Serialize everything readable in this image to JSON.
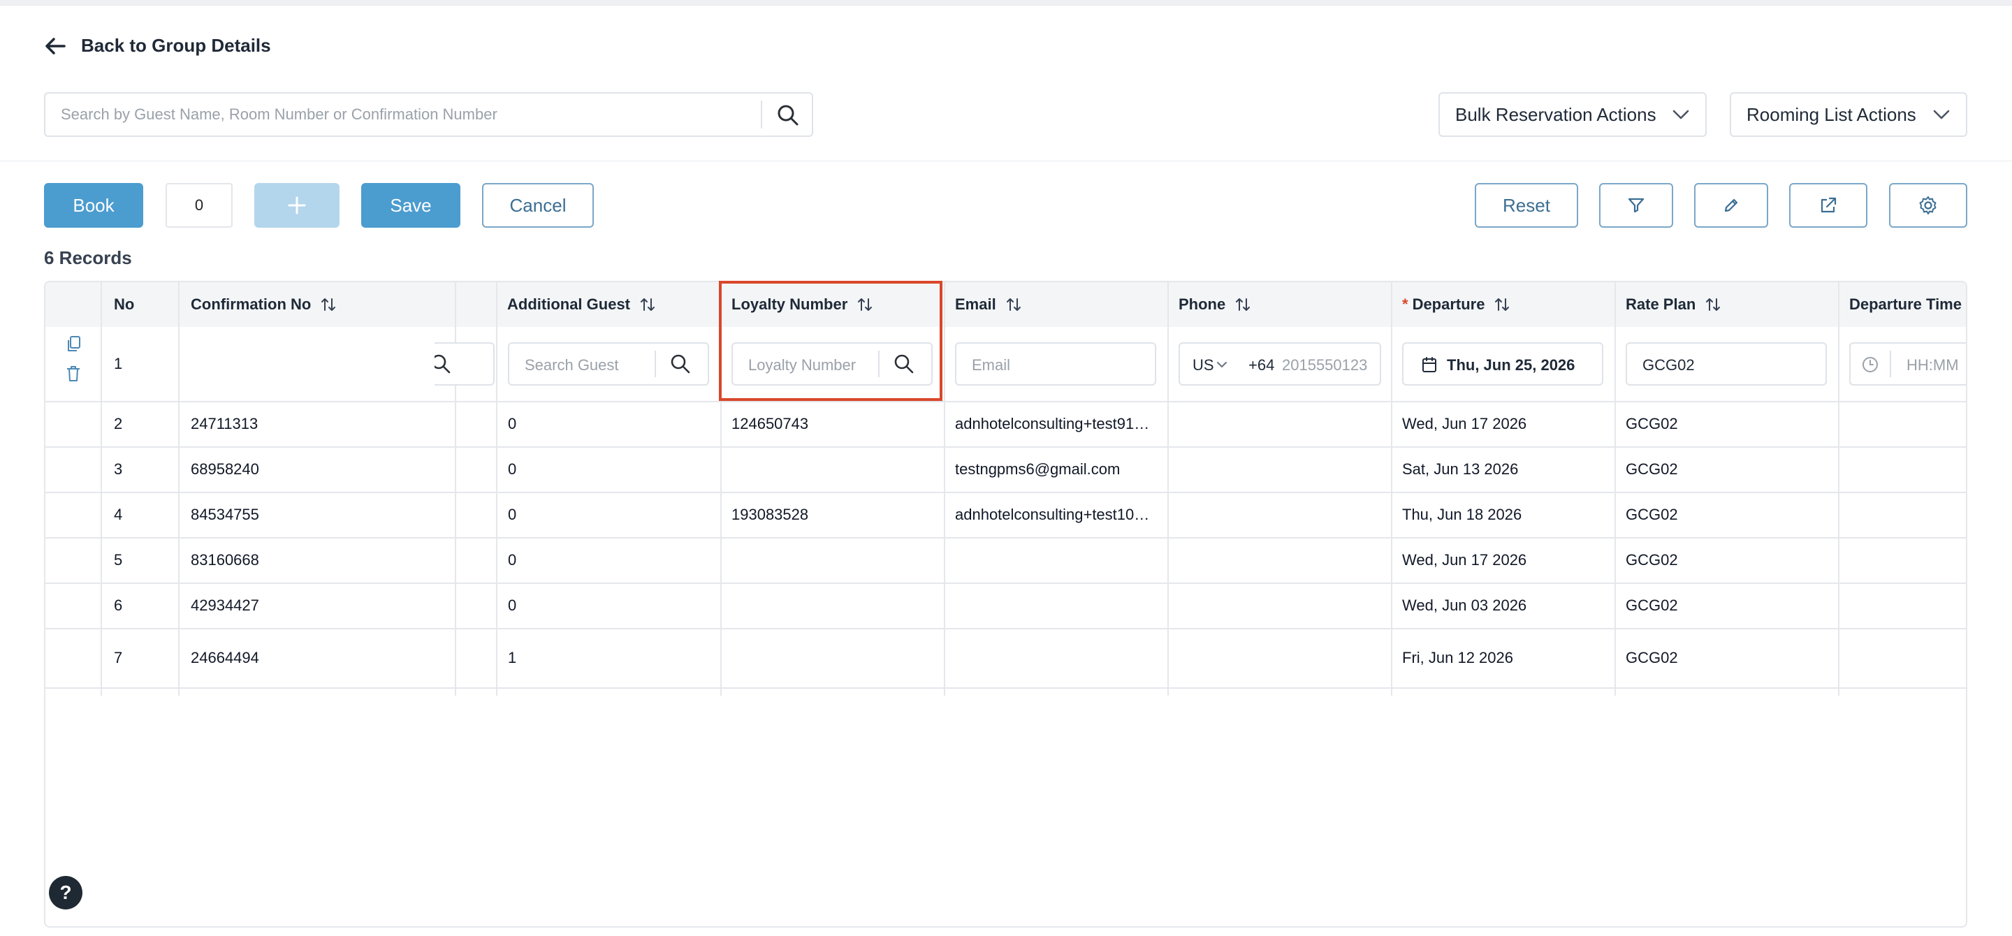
{
  "nav": {
    "back_label": "Back to Group Details"
  },
  "search": {
    "placeholder": "Search by Guest Name, Room Number or Confirmation Number",
    "value": ""
  },
  "header_actions": {
    "bulk_label": "Bulk Reservation Actions",
    "rooming_label": "Rooming List Actions"
  },
  "toolbar": {
    "book_label": "Book",
    "quantity": "0",
    "save_label": "Save",
    "cancel_label": "Cancel",
    "reset_label": "Reset"
  },
  "records_label": "6 Records",
  "columns": {
    "no": "No",
    "confirmation": "Confirmation No",
    "additional_guest": "Additional Guest",
    "loyalty": "Loyalty Number",
    "email": "Email",
    "phone": "Phone",
    "departure_required": "*",
    "departure": "Departure",
    "rate_plan": "Rate Plan",
    "departure_time": "Departure Time"
  },
  "new_row": {
    "no": "1",
    "guest_placeholder": "Search Guest",
    "loyalty_placeholder": "Loyalty Number",
    "email_placeholder": "Email",
    "phone_country": "US",
    "phone_code": "+64",
    "phone_placeholder": "2015550123",
    "departure_value": "Thu, Jun 25, 2026",
    "rate_plan_value": "GCG02",
    "time_placeholder": "HH:MM"
  },
  "rows": [
    {
      "no": "2",
      "confirmation": "24711313",
      "additional_guest": "0",
      "loyalty": "124650743",
      "email": "adnhotelconsulting+test91…",
      "phone": "",
      "departure": "Wed, Jun 17 2026",
      "rate_plan": "GCG02"
    },
    {
      "no": "3",
      "confirmation": "68958240",
      "additional_guest": "0",
      "loyalty": "",
      "email": "testngpms6@gmail.com",
      "phone": "",
      "departure": "Sat, Jun 13 2026",
      "rate_plan": "GCG02"
    },
    {
      "no": "4",
      "confirmation": "84534755",
      "additional_guest": "0",
      "loyalty": "193083528",
      "email": "adnhotelconsulting+test10…",
      "phone": "",
      "departure": "Thu, Jun 18 2026",
      "rate_plan": "GCG02"
    },
    {
      "no": "5",
      "confirmation": "83160668",
      "additional_guest": "0",
      "loyalty": "",
      "email": "",
      "phone": "",
      "departure": "Wed, Jun 17 2026",
      "rate_plan": "GCG02"
    },
    {
      "no": "6",
      "confirmation": "42934427",
      "additional_guest": "0",
      "loyalty": "",
      "email": "",
      "phone": "",
      "departure": "Wed, Jun 03 2026",
      "rate_plan": "GCG02"
    },
    {
      "no": "7",
      "confirmation": "24664494",
      "additional_guest": "1",
      "loyalty": "",
      "email": "",
      "phone": "",
      "departure": "Fri, Jun 12 2026",
      "rate_plan": "GCG02"
    }
  ],
  "help_label": "?",
  "colors": {
    "primary": "#4b9ccf",
    "primary_disabled": "#b3d6ec",
    "highlight": "#d9472b",
    "outline_text": "#3b6e93"
  }
}
